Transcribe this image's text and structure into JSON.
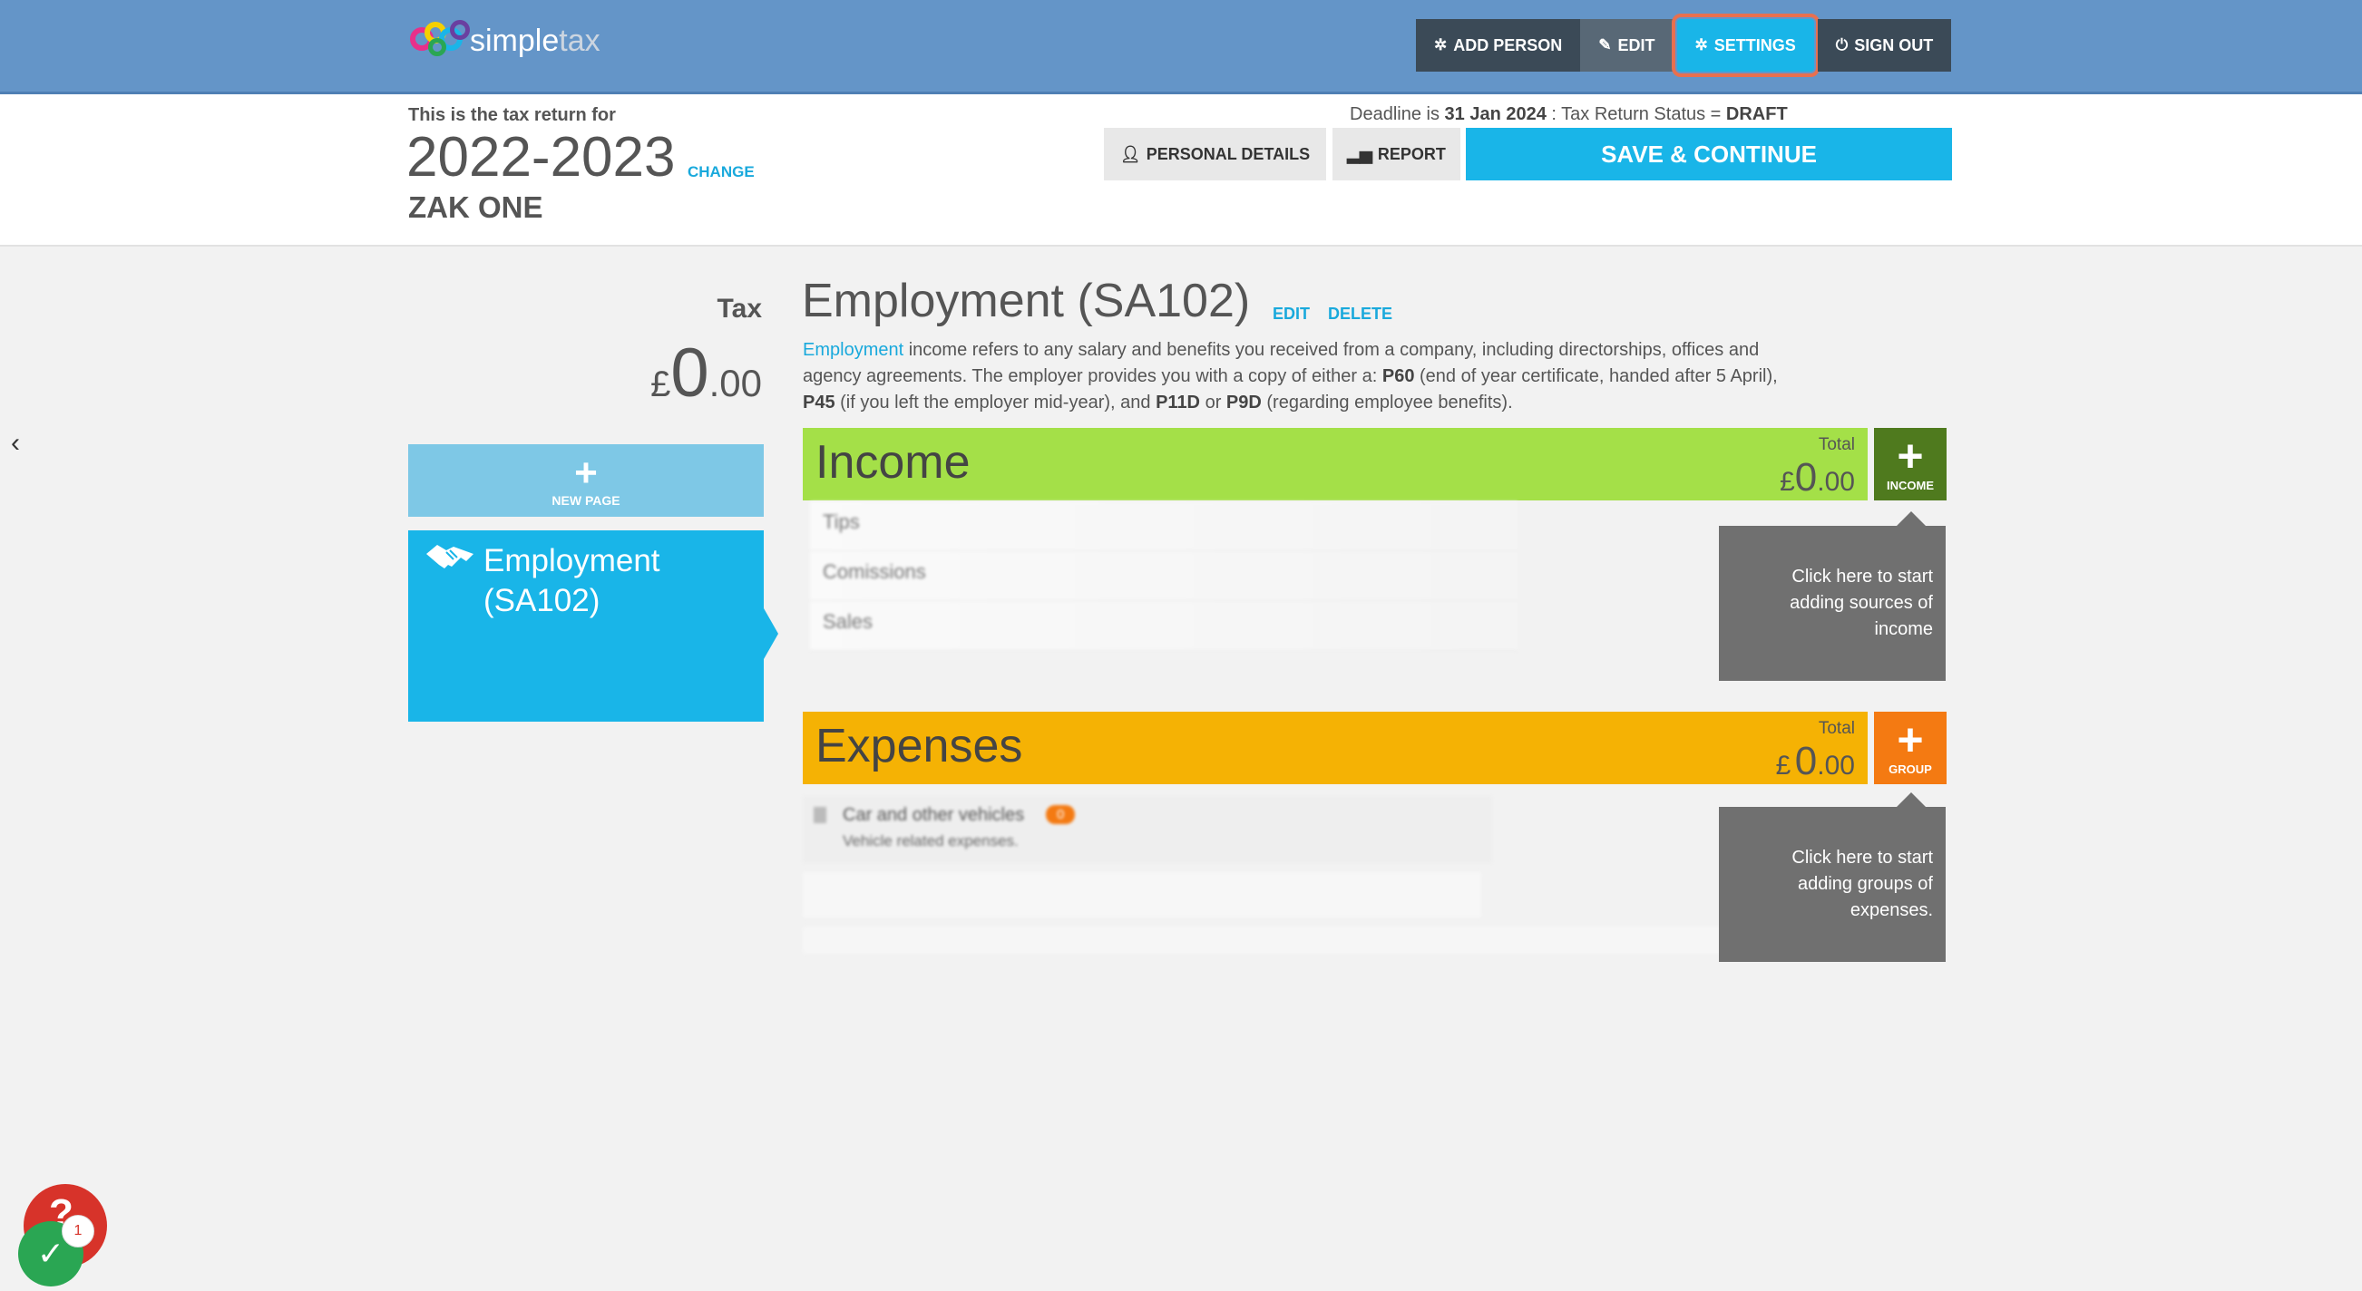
{
  "brand": {
    "name_a": "simple",
    "name_b": "tax"
  },
  "topnav": {
    "add_person": "ADD PERSON",
    "edit": "EDIT",
    "settings": "SETTINGS",
    "sign_out": "SIGN OUT"
  },
  "header": {
    "label": "This is the tax return for",
    "year": "2022-2023",
    "change": "CHANGE",
    "person": "ZAK ONE",
    "deadline_prefix": "Deadline is",
    "deadline_date": "31 Jan 2024",
    "status_prefix": ": Tax Return Status =",
    "status": "DRAFT",
    "personal_details": "PERSONAL DETAILS",
    "report": "REPORT",
    "save_continue": "SAVE & CONTINUE"
  },
  "sidebar": {
    "tax_label": "Tax",
    "tax_currency": "£",
    "tax_whole": "0",
    "tax_decimal": ".00",
    "new_page_label": "NEW PAGE",
    "page_card_title": "Employment (SA102)"
  },
  "main": {
    "title": "Employment (SA102)",
    "edit": "EDIT",
    "delete": "DELETE",
    "desc_link": "Employment",
    "desc_1": " income refers to any salary and benefits you received from a company, including directorships, offices and agency agreements. The employer provides you with a copy of either a: ",
    "desc_p60": "P60",
    "desc_2": " (end of year certificate, handed after 5 April), ",
    "desc_p45": "P45",
    "desc_3": " (if you left the employer mid-year), and ",
    "desc_p11d": "P11D",
    "desc_4": " or ",
    "desc_p9d": "P9D",
    "desc_5": " (regarding employee benefits).",
    "income": {
      "title": "Income",
      "total_label": "Total",
      "currency": "£",
      "whole": "0",
      "decimal": ".00",
      "add_label": "INCOME",
      "rows": [
        "Tips",
        "Comissions",
        "Sales"
      ],
      "tip": "Click here to start adding sources of income"
    },
    "expenses": {
      "title": "Expenses",
      "total_label": "Total",
      "currency": "£",
      "whole": "0",
      "decimal": ".00",
      "add_label": "GROUP",
      "group_name": "Car and other vehicles",
      "group_count": "0",
      "group_desc": "Vehicle related expenses.",
      "tip": "Click here to start adding groups of expenses."
    }
  },
  "widget": {
    "help": "?",
    "count": "1",
    "check": "✓"
  },
  "colors": {
    "topbar": "#6495c8",
    "accent": "#19b5e8",
    "income": "#a4e048",
    "income_add": "#4f7a1e",
    "expenses": "#f5b204",
    "expenses_add": "#f47a12",
    "tooltip": "#707070"
  }
}
